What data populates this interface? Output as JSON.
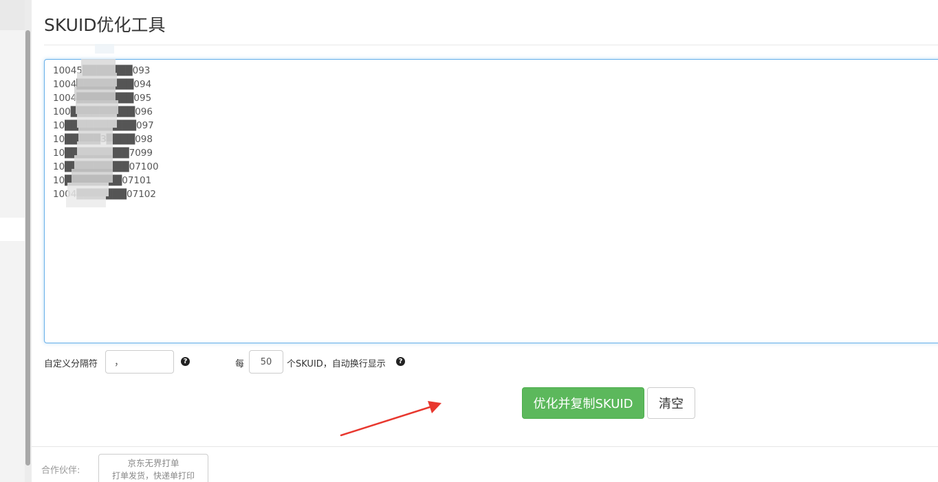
{
  "page": {
    "title": "SKUID优化工具"
  },
  "editor": {
    "lines": [
      "10045███████093",
      "1004████████094",
      "1004████████095",
      "100█████████096",
      "10██████████097",
      "10█████3████098",
      "10█████████7099",
      "10█████████07100",
      "10████████07101",
      "1004███████07102"
    ]
  },
  "options": {
    "separator_label": "自定义分隔符",
    "separator_value": "，",
    "per_label": "每",
    "per_value": "50",
    "per_suffix": "个SKUID，自动换行显示",
    "help_glyph": "?"
  },
  "actions": {
    "optimize_label": "优化并复制SKUID",
    "clear_label": "清空"
  },
  "footer": {
    "partners_label": "合作伙伴:",
    "partner": {
      "name": "京东无界打单",
      "desc": "打单发货，快递单打印"
    }
  },
  "colors": {
    "primary_green": "#5cb85c",
    "focus_blue": "#66afe9",
    "annotation_red": "#e8382f"
  }
}
